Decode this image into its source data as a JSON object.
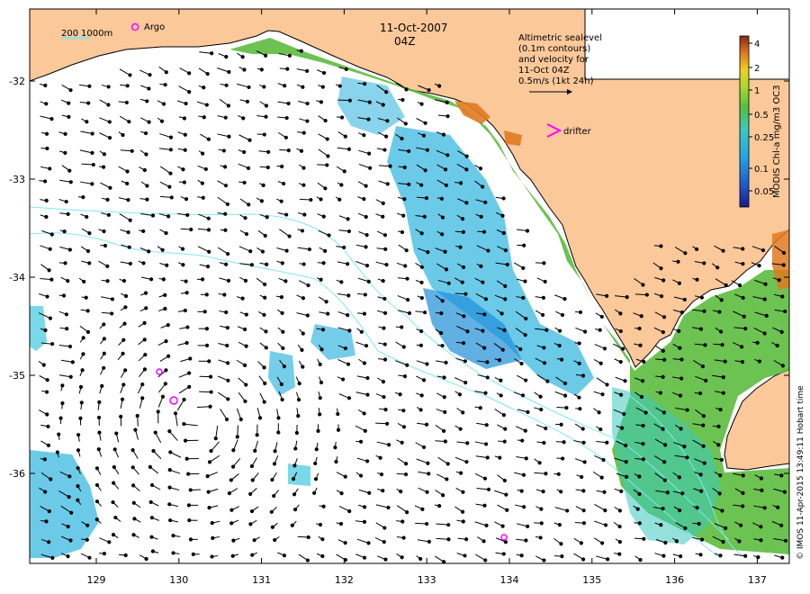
{
  "header": {
    "date": "11-Oct-2007",
    "time": "04Z"
  },
  "scale_bar": {
    "label": "200",
    "label2": "1000m"
  },
  "argo": {
    "label": "Argo",
    "marker_color": "#ff00ff"
  },
  "drifter": {
    "label": "drifter",
    "marker_color": "#ff00ff"
  },
  "altimetry_note": {
    "line1": "Altimetric sealevel",
    "line2": "(0.1m contours)",
    "line3": "and velocity for",
    "line4": "11-Oct 04Z",
    "line5": "0.5m/s (1kt 24h)"
  },
  "colorbar": {
    "title": "MODIS Chl-a mg/m3 OC3",
    "ticks": [
      "4",
      "2",
      "1",
      "0.5",
      "0.25",
      "0.1",
      "0.05"
    ]
  },
  "x_ticks": [
    "129",
    "130",
    "131",
    "132",
    "133",
    "134",
    "135",
    "136",
    "137"
  ],
  "y_ticks": [
    "-32",
    "-33",
    "-34",
    "-35",
    "-36"
  ],
  "credit": "© IMOS 11-Apr-2015 13:49:11 Hobart time",
  "colors": {
    "land": "#fbc89a",
    "contour": "#7fe8f0",
    "chl_low": "#2090d8",
    "chl_mid": "#40c8e0",
    "chl_high": "#50b830"
  }
}
